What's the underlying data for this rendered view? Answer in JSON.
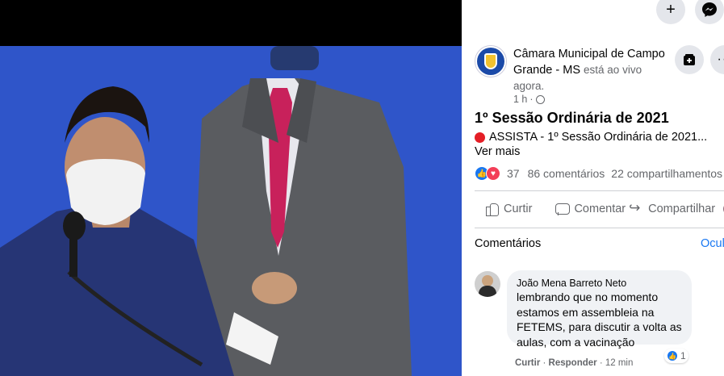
{
  "video": {
    "scene": "live-session-camera-feed"
  },
  "top_buttons": {
    "plus_icon": "plus-icon",
    "plus_glyph": "+",
    "messenger_icon": "messenger-icon"
  },
  "post": {
    "page_name": "Câmara Municipal de Campo Grande - MS",
    "live_suffix": "está ao vivo agora.",
    "time": "1 h",
    "separator": "·",
    "title": "1º Sessão Ordinária de 2021",
    "description": "ASSISTA - 1º Sessão Ordinária de 2021...",
    "see_more": "Ver mais",
    "reaction_count": "37",
    "comments_count": "86 comentários",
    "shares_count": "22 compartilhamentos",
    "more_glyph": "···"
  },
  "actions": {
    "like": "Curtir",
    "comment": "Comentar",
    "share": "Compartilhar"
  },
  "comments_section": {
    "heading": "Comentários",
    "hide": "Ocultar",
    "items": [
      {
        "author": "João Mena Barreto Neto",
        "text": "lembrando que no momento estamos em assembleia na FETEMS, para discutir a volta as aulas, com a vacinação",
        "reactions": "1",
        "like_action": "Curtir",
        "reply_action": "Responder",
        "time": "12 min"
      }
    ]
  },
  "colors": {
    "accent": "#1877f2",
    "love": "#f33e58",
    "live": "#e41e26",
    "video_bg": "#2f55c9"
  }
}
